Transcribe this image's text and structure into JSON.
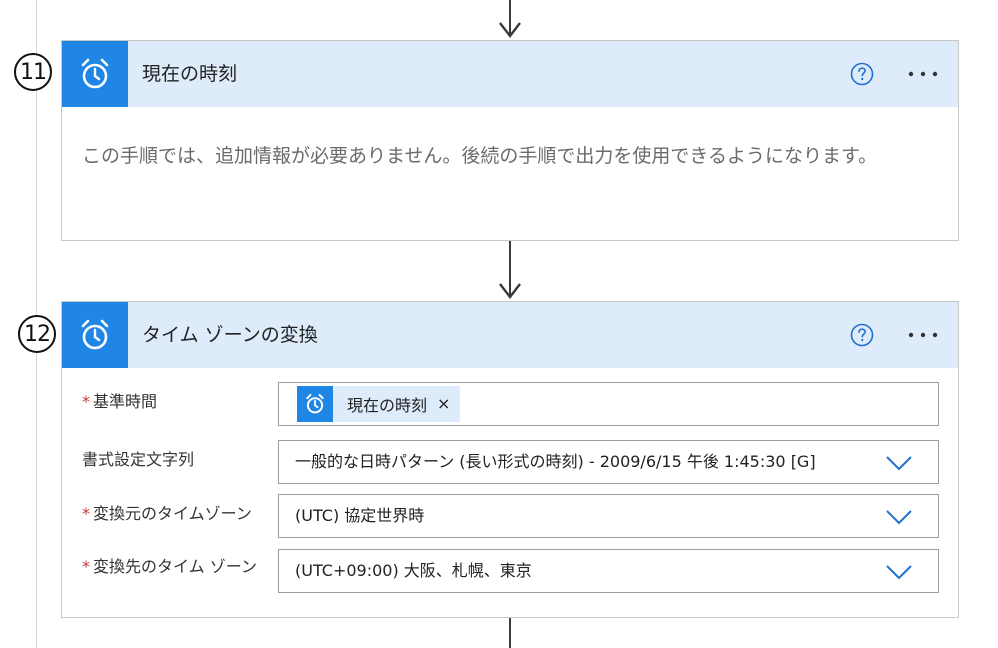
{
  "steps": [
    {
      "number": "11",
      "title": "現在の時刻",
      "body": "この手順では、追加情報が必要ありません。後続の手順で出力を使用できるようになります。"
    },
    {
      "number": "12",
      "title": "タイム ゾーンの変換",
      "fields": [
        {
          "required": true,
          "label": "基準時間",
          "token_label": "現在の時刻",
          "token_close": "×"
        },
        {
          "required": false,
          "label": "書式設定文字列",
          "value": "一般的な日時パターン (長い形式の時刻) - 2009/6/15 午後 1:45:30 [G]"
        },
        {
          "required": true,
          "label": "変換元のタイムゾーン",
          "value": "(UTC) 協定世界時"
        },
        {
          "required": true,
          "label": "変換先のタイム ゾーン",
          "value": "(UTC+09:00) 大阪、札幌、東京"
        }
      ]
    }
  ],
  "required_marker": "*",
  "colors": {
    "accent": "#1f86e6",
    "header_bg": "#deebfb",
    "required": "#c8383a",
    "muted_text": "#6b6b6b"
  },
  "icons": {
    "step_icon": "alarm-clock-icon",
    "help": "help-circle-icon",
    "more": "more-options-icon",
    "dropdown": "chevron-down-icon"
  }
}
